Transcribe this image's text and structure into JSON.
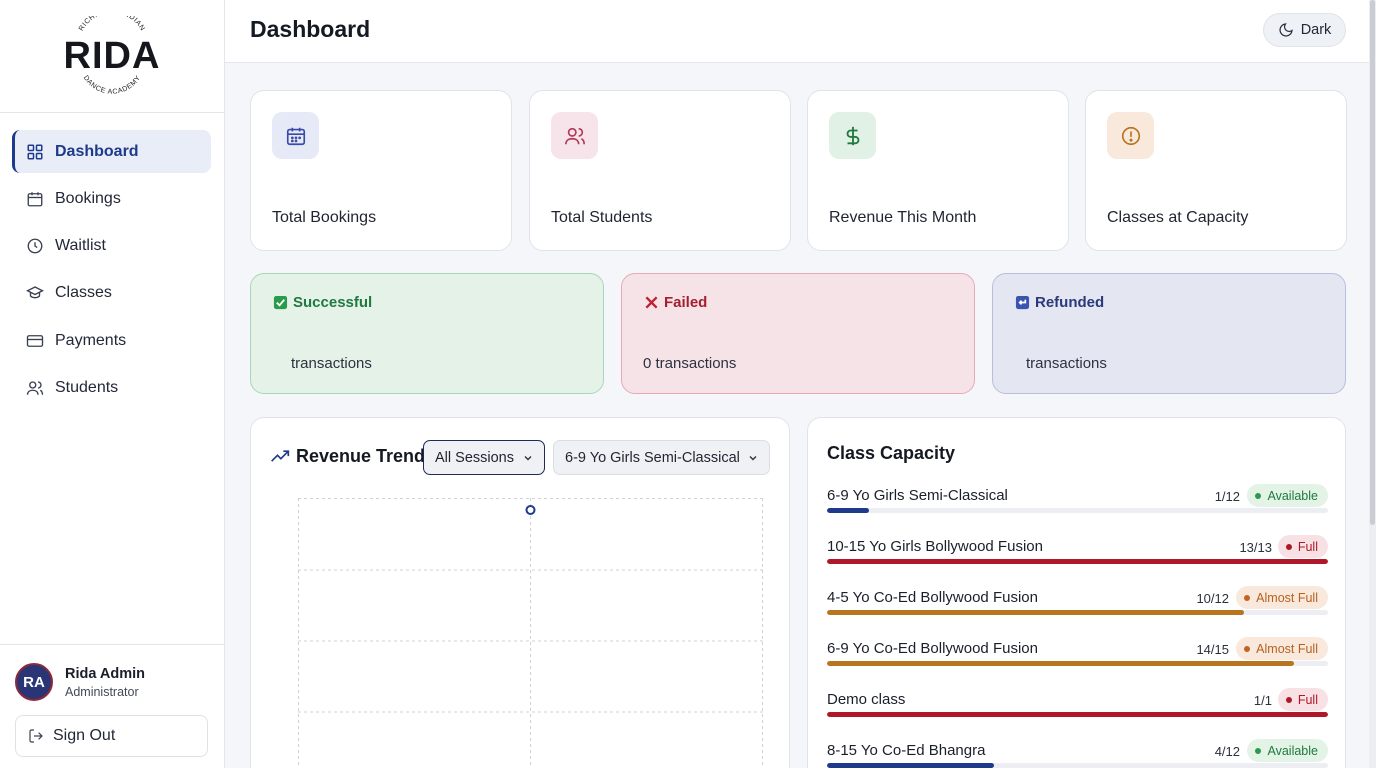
{
  "brand": {
    "logo_text": "RIDA",
    "arc_top": "RICHMOND INDIAN",
    "arc_bottom": "DANCE ACADEMY"
  },
  "header": {
    "title": "Dashboard",
    "theme_label": "Dark"
  },
  "sidebar": {
    "items": [
      {
        "label": "Dashboard",
        "icon": "grid-icon",
        "active": true
      },
      {
        "label": "Bookings",
        "icon": "calendar-icon"
      },
      {
        "label": "Waitlist",
        "icon": "clock-icon"
      },
      {
        "label": "Classes",
        "icon": "graduation-cap-icon"
      },
      {
        "label": "Payments",
        "icon": "credit-card-icon"
      },
      {
        "label": "Students",
        "icon": "users-icon"
      }
    ]
  },
  "user": {
    "initials": "RA",
    "name": "Rida Admin",
    "role": "Administrator",
    "signout_label": "Sign Out"
  },
  "stats": [
    {
      "label": "Total Bookings",
      "icon": "calendar-icon",
      "color": "#3b4aa8",
      "bg": "#e6eaf6"
    },
    {
      "label": "Total Students",
      "icon": "users-icon",
      "color": "#b03a5a",
      "bg": "#f7e3ea"
    },
    {
      "label": "Revenue This Month",
      "icon": "dollar-icon",
      "color": "#1f7a3e",
      "bg": "#e2f1e6"
    },
    {
      "label": "Classes at Capacity",
      "icon": "alert-circle-icon",
      "color": "#b8741f",
      "bg": "#f8e9dc"
    }
  ],
  "transactions": [
    {
      "label": "Successful",
      "text": "transactions",
      "color": "#1f7a3e",
      "bg": "#e4f2e8",
      "border": "#a9d7b6"
    },
    {
      "label": "Failed",
      "text": "0 transactions",
      "color": "#a3202f",
      "bg": "#f6e3e8",
      "border": "#e7a9b6"
    },
    {
      "label": "Refunded",
      "text": "transactions",
      "color": "#2a3a7a",
      "bg": "#e4e6f2",
      "border": "#b8bfdc"
    }
  ],
  "revenue": {
    "title": "Revenue Trend",
    "session_filter": "All Sessions",
    "class_filter": "6-9 Yo Girls Semi-Classical"
  },
  "capacity": {
    "title": "Class Capacity",
    "rows": [
      {
        "name": "6-9 Yo Girls Semi-Classical",
        "count": "1/12",
        "fill": 0.083,
        "status": "Available",
        "bar": "#1e3a8a",
        "badge_bg": "#e3f3e6",
        "badge_color": "#1f7a3e",
        "dot": "#2a9a4c"
      },
      {
        "name": "10-15 Yo Girls Bollywood Fusion",
        "count": "13/13",
        "fill": 1.0,
        "status": "Full",
        "bar": "#b0182a",
        "badge_bg": "#f8e1e4",
        "badge_color": "#b0182a",
        "dot": "#b0182a"
      },
      {
        "name": "4-5 Yo Co-Ed Bollywood Fusion",
        "count": "10/12",
        "fill": 0.833,
        "status": "Almost Full",
        "bar": "#b8741f",
        "badge_bg": "#f8e9dc",
        "badge_color": "#b8601f",
        "dot": "#c0641f"
      },
      {
        "name": "6-9 Yo Co-Ed Bollywood Fusion",
        "count": "14/15",
        "fill": 0.933,
        "status": "Almost Full",
        "bar": "#b8741f",
        "badge_bg": "#f8e9dc",
        "badge_color": "#b8601f",
        "dot": "#c0641f"
      },
      {
        "name": "Demo class",
        "count": "1/1",
        "fill": 1.0,
        "status": "Full",
        "bar": "#b0182a",
        "badge_bg": "#f8e1e4",
        "badge_color": "#b0182a",
        "dot": "#b0182a"
      },
      {
        "name": "8-15 Yo Co-Ed Bhangra",
        "count": "4/12",
        "fill": 0.333,
        "status": "Available",
        "bar": "#1e3a8a",
        "badge_bg": "#e3f3e6",
        "badge_color": "#1f7a3e",
        "dot": "#2a9a4c"
      }
    ]
  }
}
